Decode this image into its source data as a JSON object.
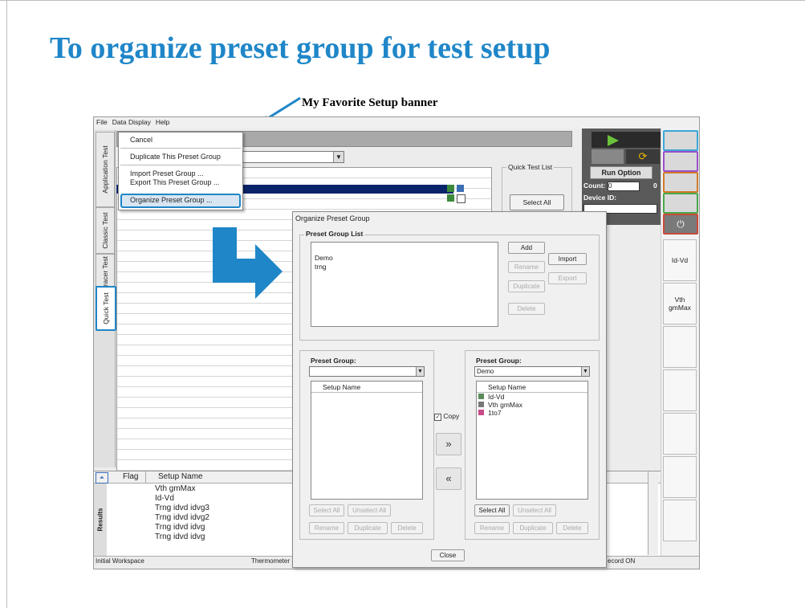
{
  "slide": {
    "title": "To organize preset group for test setup",
    "callout": "My Favorite Setup banner"
  },
  "menubar": [
    "File",
    "Data Display",
    "Help"
  ],
  "vertical_tabs": [
    "Application Test",
    "Classic Test",
    "Tracer Test",
    "Quick Test"
  ],
  "context_menu": {
    "cancel": "Cancel",
    "duplicate": "Duplicate This Preset Group",
    "import": "Import Preset Group ...",
    "export": "Export This Preset Group ...",
    "organize": "Organize Preset Group ..."
  },
  "quick_test_list": {
    "label": "Quick Test List",
    "select_all": "Select All"
  },
  "run_panel": {
    "run_option": "Run Option",
    "count_label": "Count:",
    "count_value": "0",
    "count_extra": "0",
    "device_id_label": "Device ID:"
  },
  "preset_buttons": [
    "Id-Vd",
    "Vth gmMax"
  ],
  "results": {
    "side_label": "Results",
    "headers": [
      "Flag",
      "Setup Name"
    ],
    "rows": [
      "Vth gmMax",
      "Id-Vd",
      "Trng idvd idvg3",
      "Trng idvd idvg2",
      "Trng idvd idvg",
      "Trng idvd idvg"
    ]
  },
  "statusbar": {
    "workspace": "Initial Workspace",
    "thermometer": "Thermometer",
    "record": "ecord ON"
  },
  "dialog": {
    "title": "Organize Preset Group",
    "preset_group_list_label": "Preset Group List",
    "groups": [
      "Demo",
      "trng"
    ],
    "buttons": {
      "add": "Add",
      "rename": "Rename",
      "duplicate": "Duplicate",
      "delete": "Delete",
      "import": "Import",
      "export": "Export"
    },
    "left_panel": {
      "label": "Preset Group:",
      "combo_value": "",
      "column": "Setup Name",
      "select_all": "Select All",
      "unselect_all": "Unselect All",
      "rename": "Rename",
      "duplicate": "Duplicate",
      "delete": "Delete"
    },
    "right_panel": {
      "label": "Preset Group:",
      "combo_value": "Demo",
      "column": "Setup Name",
      "items": [
        "Id-Vd",
        "Vth gmMax",
        "1to7"
      ],
      "select_all": "Select All",
      "unselect_all": "Unselect All",
      "rename": "Rename",
      "duplicate": "Duplicate",
      "delete": "Delete"
    },
    "copy_label": "Copy",
    "move_right": "»",
    "move_left": "«",
    "close": "Close"
  },
  "colors": {
    "title": "#1f86c8",
    "highlight": "#1f86c8",
    "selection": "#0a246a",
    "play": "#6ac23a"
  }
}
